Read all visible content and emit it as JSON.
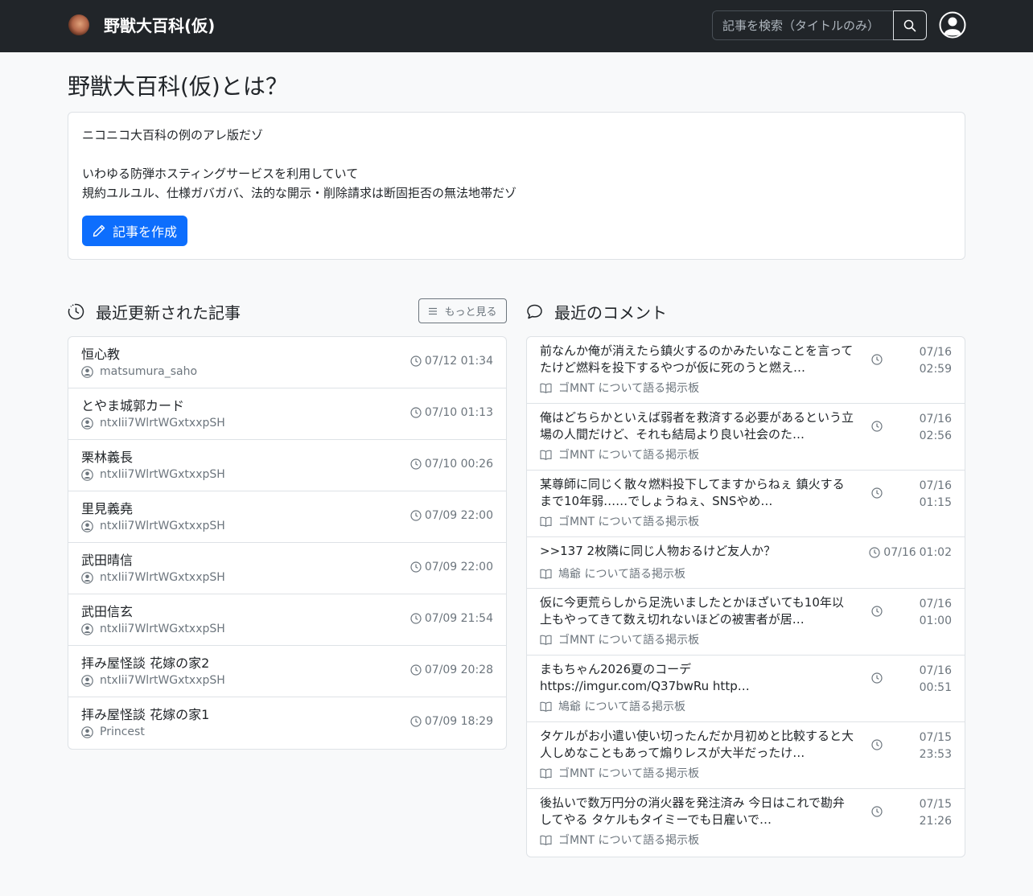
{
  "navbar": {
    "brand": "野獣大百科(仮)",
    "search_placeholder": "記事を検索（タイトルのみ）",
    "search_icon": "search-icon",
    "user_icon": "person-circle-icon"
  },
  "intro": {
    "title": "野獣大百科(仮)とは？",
    "line1": "ニコニコ大百科の例のアレ版だゾ",
    "line2": "いわゆる防弾ホスティングサービスを利用していて",
    "line3": "規約ユルユル、仕様ガバガバ、法的な開示・削除請求は断固拒否の無法地帯だゾ",
    "create_label": "記事を作成"
  },
  "recent_articles": {
    "heading": "最近更新された記事",
    "more_label": "もっと見る",
    "items": [
      {
        "title": "恒心教",
        "author": "matsumura_saho",
        "time": "07/12 01:34"
      },
      {
        "title": "とやま城郭カード",
        "author": "ntxIii7WlrtWGxtxxpSH",
        "time": "07/10 01:13"
      },
      {
        "title": "栗林義長",
        "author": "ntxIii7WlrtWGxtxxpSH",
        "time": "07/10 00:26"
      },
      {
        "title": "里見義堯",
        "author": "ntxIii7WlrtWGxtxxpSH",
        "time": "07/09 22:00"
      },
      {
        "title": "武田晴信",
        "author": "ntxIii7WlrtWGxtxxpSH",
        "time": "07/09 22:00"
      },
      {
        "title": "武田信玄",
        "author": "ntxIii7WlrtWGxtxxpSH",
        "time": "07/09 21:54"
      },
      {
        "title": "拝み屋怪談 花嫁の家2",
        "author": "ntxIii7WlrtWGxtxxpSH",
        "time": "07/09 20:28"
      },
      {
        "title": "拝み屋怪談 花嫁の家1",
        "author": "Princest",
        "time": "07/09 18:29"
      }
    ]
  },
  "recent_comments": {
    "heading": "最近のコメント",
    "items": [
      {
        "text": "前なんか俺が消えたら鎮火するのかみたいなことを言ってたけど燃料を投下するやつが仮に死のうと燃え…",
        "board": "ゴMNT について語る掲示板",
        "date": "07/16",
        "time": "02:59"
      },
      {
        "text": "俺はどちらかといえば弱者を救済する必要があるという立場の人間だけど、それも結局より良い社会のた…",
        "board": "ゴMNT について語る掲示板",
        "date": "07/16",
        "time": "02:56"
      },
      {
        "text": "某尊師に同じく散々燃料投下してますからねぇ 鎮火するまで10年弱……でしょうねぇ、SNSやめ…",
        "board": "ゴMNT について語る掲示板",
        "date": "07/16",
        "time": "01:15"
      },
      {
        "text": ">>137 2枚隣に同じ人物おるけど友人か？",
        "board": "鳩爺 について語る掲示板",
        "date": "07/16",
        "time": "01:02"
      },
      {
        "text": "仮に今更荒らしから足洗いましたとかほざいても10年以上もやってきて数え切れないほどの被害者が居…",
        "board": "ゴMNT について語る掲示板",
        "date": "07/16",
        "time": "01:00"
      },
      {
        "text": "まもちゃん2026夏のコーデ https://imgur.com/Q37bwRu http…",
        "board": "鳩爺 について語る掲示板",
        "date": "07/16",
        "time": "00:51"
      },
      {
        "text": "タケルがお小遣い使い切ったんだか月初めと比較すると大人しめなこともあって煽りレスが大半だったけ…",
        "board": "ゴMNT について語る掲示板",
        "date": "07/15",
        "time": "23:53"
      },
      {
        "text": "後払いで数万円分の消火器を発注済み 今日はこれで勘弁してやる タケルもタイミーでも日雇いで…",
        "board": "ゴMNT について語る掲示板",
        "date": "07/15",
        "time": "21:26"
      }
    ]
  },
  "colors": {
    "navbar_bg": "#212529",
    "primary": "#0d6efd",
    "muted": "#6c757d",
    "page_bg": "#f8f9fa"
  }
}
